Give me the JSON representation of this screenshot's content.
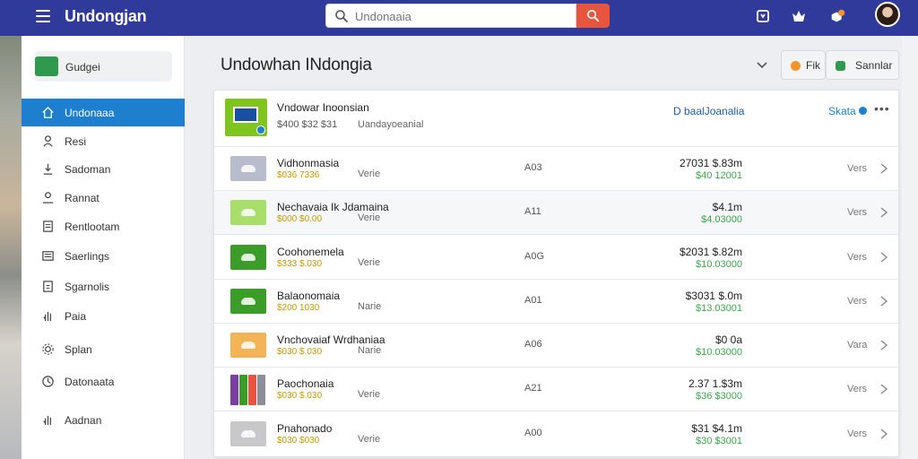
{
  "app": {
    "title": "Undongjan"
  },
  "search": {
    "placeholder": "Undonaaia",
    "value": ""
  },
  "topbar": {
    "icons": [
      "bookmark-icon",
      "crown-icon",
      "notification-icon",
      "avatar"
    ]
  },
  "sidebar": {
    "header_label": "Gudgei",
    "items": [
      {
        "label": "Undonaaa",
        "icon": "home-icon",
        "active": true
      },
      {
        "label": "Resi",
        "icon": "person-icon",
        "active": false
      },
      {
        "label": "Sadoman",
        "icon": "download-icon",
        "active": false
      },
      {
        "label": "Rannat",
        "icon": "user-icon",
        "active": false
      },
      {
        "label": "Rentlootam",
        "icon": "document-icon",
        "active": false
      },
      {
        "label": "Saerlings",
        "icon": "list-icon",
        "active": false
      },
      {
        "label": "Sgarnolis",
        "icon": "file-icon",
        "active": false
      },
      {
        "label": "Paia",
        "icon": "hand-icon",
        "active": false
      },
      {
        "label": "Splan",
        "icon": "gear-icon",
        "active": false
      },
      {
        "label": "Datonaata",
        "icon": "clock-icon",
        "active": false
      },
      {
        "label": "Aadnan",
        "icon": "hand-icon",
        "active": false
      }
    ]
  },
  "main": {
    "title": "Undowhan INdongia",
    "buttons": [
      {
        "label": "Fik",
        "color": "#f0952b"
      },
      {
        "label": "Sannlar",
        "color": "#2f9a4d"
      }
    ]
  },
  "card": {
    "header": {
      "name": "Vndowar Inoonsian",
      "sub1": "$400 $32 $31",
      "sub2": "Uandayoeanial",
      "link": "D baalJoanalia",
      "status": "Skata"
    },
    "rows": [
      {
        "name": "Vidhonmasia",
        "price": "$036 7336",
        "verb": "Verie",
        "code": "A03",
        "val": "27031 $.83m",
        "val2": "$40 12001",
        "action": "Vers",
        "thumb_color": "#b9bccd"
      },
      {
        "name": "Nechavaia Ik Jdamaina",
        "price": "$000 $0.00",
        "verb": "Verie",
        "code": "A11",
        "val": "$4.1m",
        "val2": "$4.03000",
        "action": "Vers",
        "thumb_color": "#a9de6a"
      },
      {
        "name": "Coohonemela",
        "price": "$333 $.030",
        "verb": "Verie",
        "code": "A0G",
        "val": "$2031 $.82m",
        "val2": "$10.03000",
        "action": "Vers",
        "thumb_color": "#3c9c2a"
      },
      {
        "name": "Balaonomaia",
        "price": "$200 1030",
        "verb": "Narie",
        "code": "A01",
        "val": "$3031 $.0m",
        "val2": "$13.03001",
        "action": "Vers",
        "thumb_color": "#3c9c2a"
      },
      {
        "name": "Vnchovaiaf Wrdhaniaa",
        "price": "$030 $.030",
        "verb": "Narie",
        "code": "A06",
        "val": "$0 0a",
        "val2": "$10.03000",
        "action": "Vara",
        "thumb_color": "#f2b457"
      },
      {
        "name": "Paochonaia",
        "price": "$030 $.030",
        "verb": "Verie",
        "code": "A21",
        "val": "2.37 1.$3m",
        "val2": "$36 $3000",
        "action": "Vers",
        "thumb_color": "multi"
      },
      {
        "name": "Pnahonado",
        "price": "$030 $030",
        "verb": "Verie",
        "code": "A00",
        "val": "$31 $4.1m",
        "val2": "$30 $3001",
        "action": "Vers",
        "thumb_color": "#c8c8ca"
      }
    ]
  }
}
